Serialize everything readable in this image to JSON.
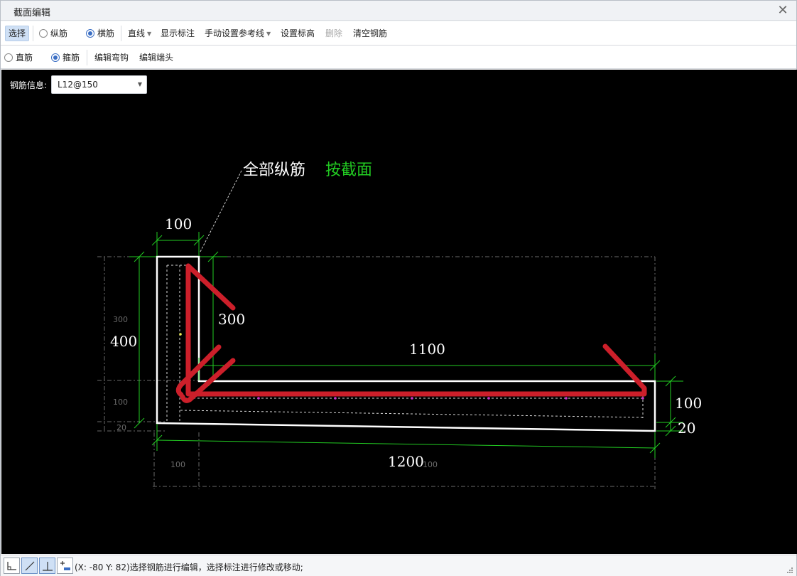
{
  "window": {
    "title": "截面编辑",
    "close_glyph": "✕"
  },
  "toolbar1": {
    "select": "选择",
    "longitudinal": "纵筋",
    "transverse": "横筋",
    "straight_line": "直线",
    "show_dims": "显示标注",
    "manual_ref": "手动设置参考线",
    "set_elevation": "设置标高",
    "delete": "删除",
    "clear_rebar": "清空钢筋"
  },
  "toolbar2": {
    "straight_bar": "直筋",
    "stirrup": "箍筋",
    "edit_hook": "编辑弯钩",
    "edit_end": "编辑端头"
  },
  "rebar_info": {
    "label": "钢筋信息:",
    "value": "L12@150"
  },
  "drawing": {
    "annotation_all": "全部纵筋",
    "annotation_mode": "按截面",
    "dim_100_top": "100",
    "dim_300": "300",
    "dim_400": "400",
    "dim_1100": "1100",
    "dim_100_right": "100",
    "dim_20_right": "20",
    "dim_1200": "1200",
    "small_300": "300",
    "small_100_left": "100",
    "small_20_left": "20",
    "small_100_bottom": "100",
    "small_100_mid": "100",
    "colors": {
      "rebar": "#cc1f2a",
      "outline": "#ffffff",
      "dim": "#22cc22",
      "text_green": "#22cc22"
    }
  },
  "status": {
    "text": "(X: -80 Y: 82)选择钢筋进行编辑，选择标注进行修改或移动;"
  }
}
